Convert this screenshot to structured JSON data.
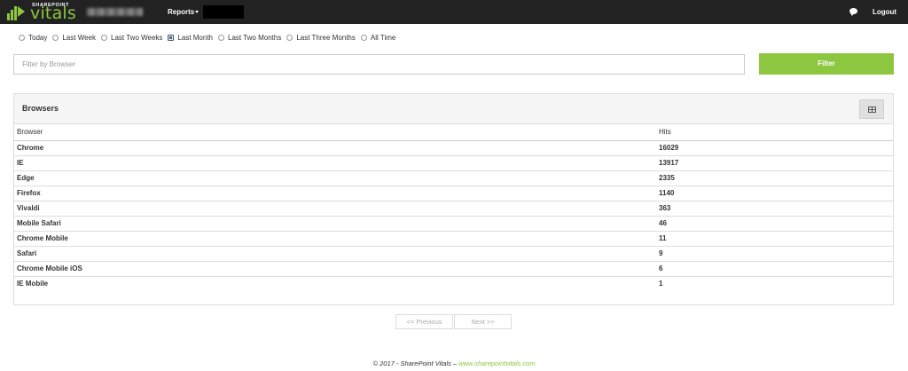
{
  "brand": {
    "small": "SHAREPOINT",
    "big": "vitals"
  },
  "nav": {
    "reports_label": "Reports",
    "logout_label": "Logout"
  },
  "date_ranges": [
    {
      "label": "Today",
      "checked": false
    },
    {
      "label": "Last Week",
      "checked": false
    },
    {
      "label": "Last Two Weeks",
      "checked": false
    },
    {
      "label": "Last Month",
      "checked": true
    },
    {
      "label": "Last Two Months",
      "checked": false
    },
    {
      "label": "Last Three Months",
      "checked": false
    },
    {
      "label": "All Time",
      "checked": false
    }
  ],
  "filter": {
    "placeholder": "Filter by Browser",
    "value": "",
    "button_label": "Filter"
  },
  "panel": {
    "title": "Browsers"
  },
  "table": {
    "headers": [
      "Browser",
      "Hits"
    ],
    "rows": [
      [
        "Chrome",
        "16029"
      ],
      [
        "IE",
        "13917"
      ],
      [
        "Edge",
        "2335"
      ],
      [
        "Firefox",
        "1140"
      ],
      [
        "Vivaldi",
        "363"
      ],
      [
        "Mobile Safari",
        "46"
      ],
      [
        "Chrome Mobile",
        "11"
      ],
      [
        "Safari",
        "9"
      ],
      [
        "Chrome Mobile iOS",
        "6"
      ],
      [
        "IE Mobile",
        "1"
      ]
    ]
  },
  "pager": {
    "prev_label": "<< Previous",
    "next_label": "Next >>"
  },
  "footer": {
    "copyright": "© 2017 - SharePoint Vitals – ",
    "link_text": "www.sharepointvitals.com"
  },
  "colors": {
    "accent": "#8dc63f",
    "topbar": "#222222"
  }
}
